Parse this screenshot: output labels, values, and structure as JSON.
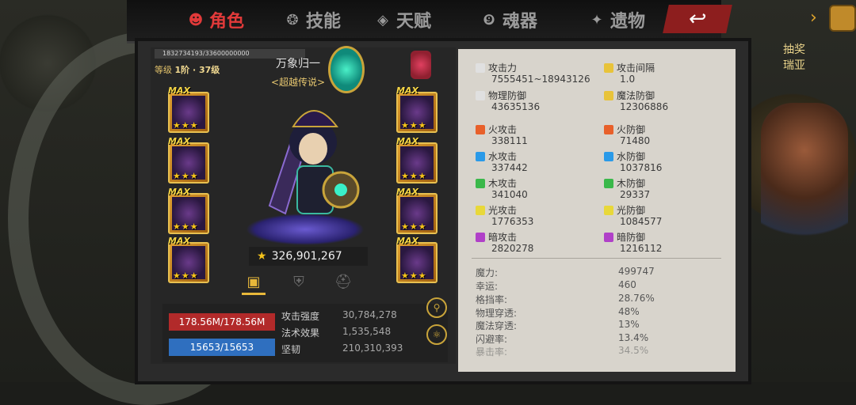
{
  "nav": {
    "tabs": [
      {
        "label": "角色",
        "icon": "character-icon",
        "active": true
      },
      {
        "label": "技能",
        "icon": "skill-icon"
      },
      {
        "label": "天赋",
        "icon": "talent-icon"
      },
      {
        "label": "魂器",
        "icon": "soul-artifact-icon"
      },
      {
        "label": "遗物",
        "icon": "relic-icon"
      }
    ],
    "back_icon": "back-arrow-icon"
  },
  "side": {
    "event_label": "抽奖",
    "npc_name": "瑞亚"
  },
  "hero": {
    "id_bar": "1832734193/33600000000",
    "level_prefix": "等级",
    "level_value": "1阶 · 37级",
    "name": "万象归一",
    "rank": "<超越传说>",
    "power": "326,901,267"
  },
  "equipment_slots": [
    {
      "max": "MAX",
      "stars": "★★★"
    },
    {
      "max": "MAX",
      "stars": "★★★"
    },
    {
      "max": "MAX",
      "stars": "★★★"
    },
    {
      "max": "MAX",
      "stars": "★★★"
    },
    {
      "max": "MAX",
      "stars": "★★★"
    },
    {
      "max": "MAX",
      "stars": "★★★"
    },
    {
      "max": "MAX",
      "stars": "★★★"
    },
    {
      "max": "MAX",
      "stars": "★★★"
    }
  ],
  "bars": {
    "hp": "178.56M/178.56M",
    "mp": "15653/15653"
  },
  "mini_stats": [
    {
      "label": "攻击强度",
      "value": "30,784,278"
    },
    {
      "label": "法术效果",
      "value": "1,535,548"
    },
    {
      "label": "坚韧",
      "value": "210,310,393"
    }
  ],
  "stats": [
    {
      "label": "攻击力",
      "value": "7555451~18943126",
      "color": "#e0e0e0"
    },
    {
      "label": "攻击间隔",
      "value": "1.0",
      "color": "#e8c33a"
    },
    {
      "label": "物理防御",
      "value": "43635136",
      "color": "#e0e0e0"
    },
    {
      "label": "魔法防御",
      "value": "12306886",
      "color": "#e8c33a"
    },
    {
      "label": "火攻击",
      "value": "338111",
      "color": "#e8602a"
    },
    {
      "label": "火防御",
      "value": "71480",
      "color": "#e8602a"
    },
    {
      "label": "水攻击",
      "value": "337442",
      "color": "#2a9ae8"
    },
    {
      "label": "水防御",
      "value": "1037816",
      "color": "#2a9ae8"
    },
    {
      "label": "木攻击",
      "value": "341040",
      "color": "#3ab84a"
    },
    {
      "label": "木防御",
      "value": "29337",
      "color": "#3ab84a"
    },
    {
      "label": "光攻击",
      "value": "1776353",
      "color": "#e8d83a"
    },
    {
      "label": "光防御",
      "value": "1084577",
      "color": "#e8d83a"
    },
    {
      "label": "暗攻击",
      "value": "2820278",
      "color": "#b040c8"
    },
    {
      "label": "暗防御",
      "value": "1216112",
      "color": "#b040c8"
    }
  ],
  "extra_stats": [
    {
      "label": "魔力:",
      "value": "499747"
    },
    {
      "label": "幸运:",
      "value": "460"
    },
    {
      "label": "格挡率:",
      "value": "28.76%"
    },
    {
      "label": "物理穿透:",
      "value": "48%"
    },
    {
      "label": "魔法穿透:",
      "value": "13%"
    },
    {
      "label": "闪避率:",
      "value": "13.4%"
    },
    {
      "label": "暴击率:",
      "value": "34.5%"
    }
  ]
}
